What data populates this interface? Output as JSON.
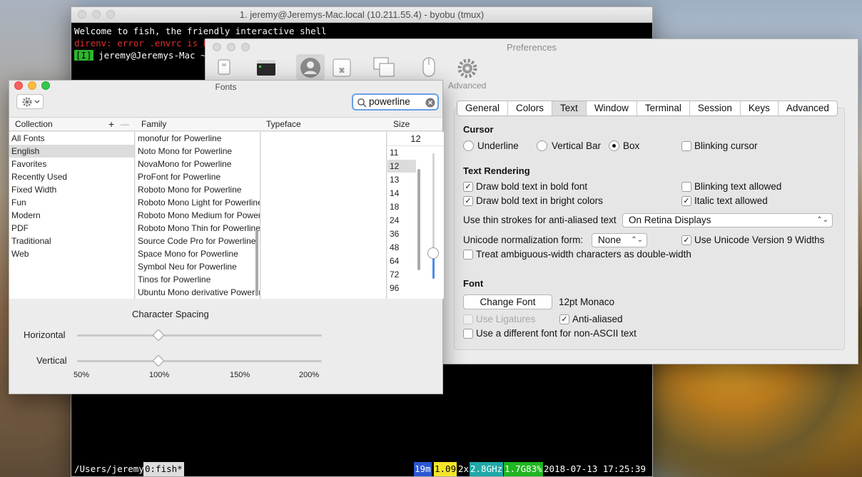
{
  "terminal": {
    "title": "1. jeremy@Jeremys-Mac.local (10.211.55.4) - byobu (tmux)",
    "lines": [
      "Welcome to fish, the friendly interactive shell",
      "direnv: error .envrc is bl"
    ],
    "prompt_badge": "[I]",
    "prompt_text": " jeremy@Jeremys-Mac ~>",
    "status": {
      "path": "/Users/jeremy",
      "window": "0:fish*",
      "uptime": "19m",
      "load": "1.09",
      "cpu": "2x",
      "ghz": "2.8GHz",
      "mem": "1.7G83%",
      "datetime": "2018-07-13 17:25:39"
    }
  },
  "preferences": {
    "title": "Preferences",
    "toolbar_advanced": "Advanced",
    "tabs": [
      "General",
      "Colors",
      "Text",
      "Window",
      "Terminal",
      "Session",
      "Keys",
      "Advanced"
    ],
    "active_tab": "Text",
    "cursor": {
      "heading": "Cursor",
      "options": [
        "Underline",
        "Vertical Bar",
        "Box"
      ],
      "selected": "Box",
      "blinking_label": "Blinking cursor"
    },
    "text_rendering": {
      "heading": "Text Rendering",
      "bold_font": "Draw bold text in bold font",
      "blinking_allowed": "Blinking text allowed",
      "bright_colors": "Draw bold text in bright colors",
      "italic_allowed": "Italic text allowed",
      "thin_strokes_label": "Use thin strokes for anti-aliased text",
      "thin_strokes_value": "On Retina Displays",
      "unicode_label": "Unicode normalization form:",
      "unicode_value": "None",
      "unicode9_label": "Use Unicode Version 9 Widths",
      "ambiguous_label": "Treat ambiguous-width characters as double-width"
    },
    "font": {
      "heading": "Font",
      "change_button": "Change Font",
      "current": "12pt Monaco",
      "ligatures": "Use Ligatures",
      "anti_aliased": "Anti-aliased",
      "non_ascii": "Use a different font for non-ASCII text"
    }
  },
  "fonts_panel": {
    "title": "Fonts",
    "search_value": "powerline",
    "headers": {
      "collection": "Collection",
      "family": "Family",
      "typeface": "Typeface",
      "size": "Size",
      "plus": "+",
      "minus": "—"
    },
    "collections": [
      "All Fonts",
      "English",
      "Favorites",
      "Recently Used",
      "Fixed Width",
      "Fun",
      "Modern",
      "PDF",
      "Traditional",
      "Web"
    ],
    "selected_collection": "English",
    "families": [
      "monofur for Powerline",
      "Noto Mono for Powerline",
      "NovaMono for Powerline",
      "ProFont for Powerline",
      "Roboto Mono for Powerline",
      "Roboto Mono Light for Powerline",
      "Roboto Mono Medium for Powerline",
      "Roboto Mono Thin for Powerline",
      "Source Code Pro for Powerline",
      "Space Mono for Powerline",
      "Symbol Neu for Powerline",
      "Tinos for Powerline",
      "Ubuntu Mono derivative Powerline"
    ],
    "size_value": "12",
    "sizes": [
      "11",
      "12",
      "13",
      "14",
      "18",
      "24",
      "36",
      "48",
      "64",
      "72",
      "96"
    ],
    "selected_size": "12",
    "character_spacing": {
      "heading": "Character Spacing",
      "horizontal": "Horizontal",
      "vertical": "Vertical",
      "ticks": [
        "50%",
        "100%",
        "150%",
        "200%"
      ],
      "horizontal_value_pct": 100,
      "vertical_value_pct": 100
    }
  },
  "colors": {
    "accent": "#6aa0e6",
    "prompt_green": "#2fb52f",
    "error_red": "#e03030"
  }
}
